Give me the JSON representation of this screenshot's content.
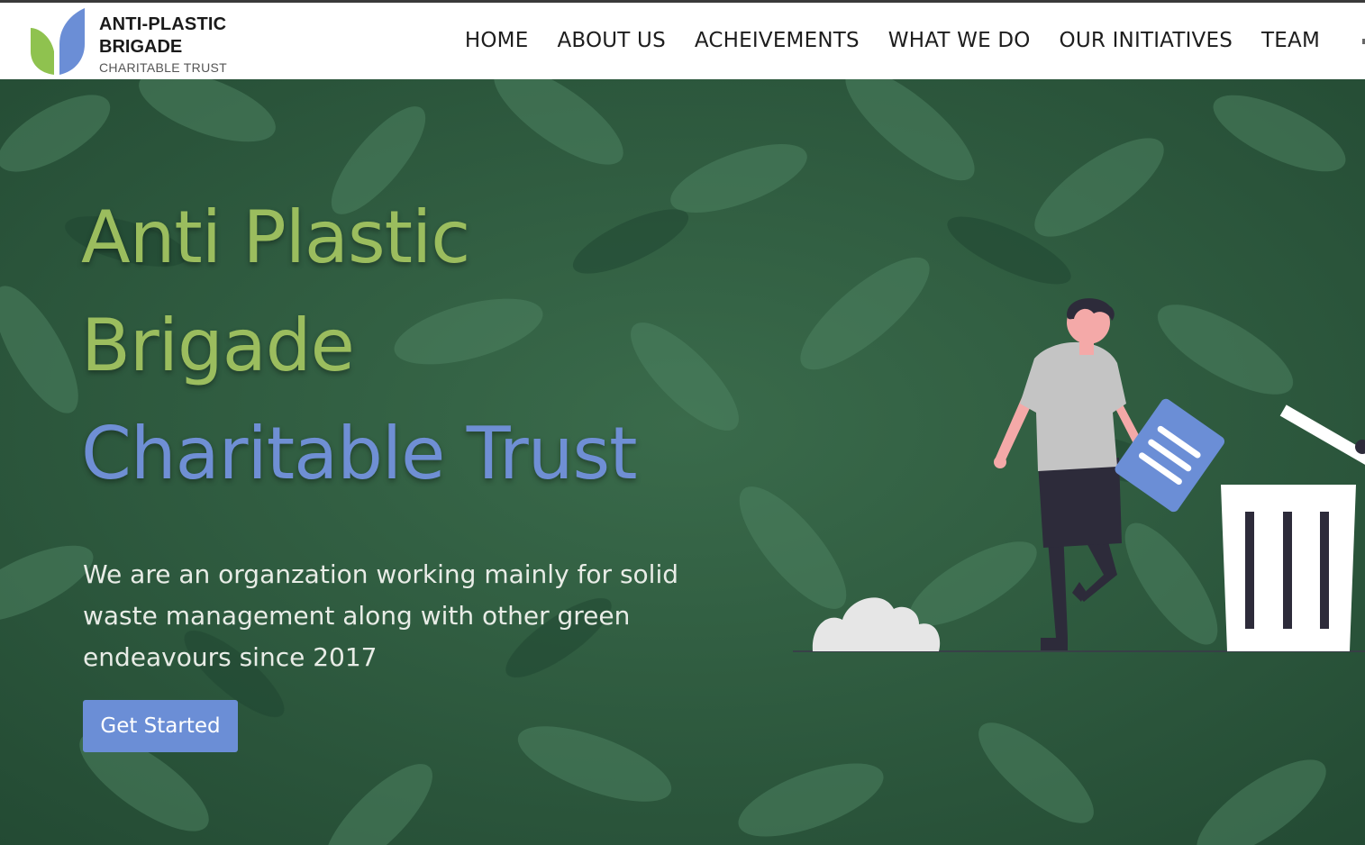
{
  "brand": {
    "line1": "ANTI-PLASTIC",
    "line2": "BRIGADE",
    "line3": "CHARITABLE TRUST",
    "colors": {
      "green": "#9bbd5e",
      "blue": "#6f8fd4"
    }
  },
  "nav": {
    "items": [
      {
        "label": "HOME"
      },
      {
        "label": "ABOUT US"
      },
      {
        "label": "ACHEIVEMENTS"
      },
      {
        "label": "WHAT WE DO"
      },
      {
        "label": "OUR INITIATIVES"
      },
      {
        "label": "TEAM"
      }
    ]
  },
  "hero": {
    "title_line1": "Anti Plastic",
    "title_line2": "Brigade",
    "title_line3": "Charitable Trust",
    "subtitle": "We are an organzation working mainly for solid waste management along with other green endeavours since 2017",
    "cta_label": "Get Started",
    "background": "leaves-photo",
    "illustration": "person-discarding-paper-into-bin"
  }
}
